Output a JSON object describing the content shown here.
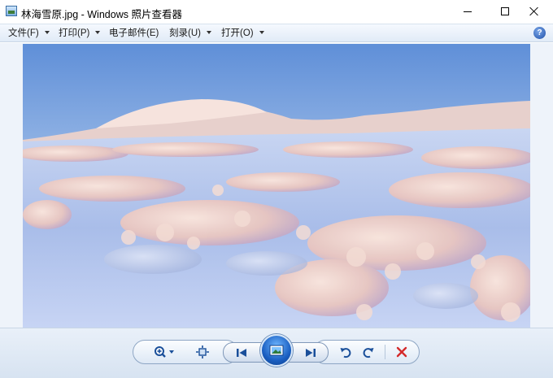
{
  "window": {
    "title": "林海雪原.jpg - Windows 照片查看器",
    "icon": "photo-viewer-icon"
  },
  "menu": {
    "items": [
      {
        "label": "文件(F)",
        "has_dropdown": true
      },
      {
        "label": "打印(P)",
        "has_dropdown": true
      },
      {
        "label": "电子邮件(E)",
        "has_dropdown": false
      },
      {
        "label": "刻录(U)",
        "has_dropdown": true
      },
      {
        "label": "打开(O)",
        "has_dropdown": true
      }
    ],
    "help_glyph": "?"
  },
  "toolbar": {
    "buttons": [
      "zoom-icon",
      "actual-size-icon",
      "previous-icon",
      "slideshow-icon",
      "next-icon",
      "rotate-left-icon",
      "rotate-right-icon",
      "delete-icon"
    ]
  },
  "colors": {
    "accent": "#1a5fc2",
    "delete": "#d42a2a",
    "chrome": "#e1ebf7"
  }
}
